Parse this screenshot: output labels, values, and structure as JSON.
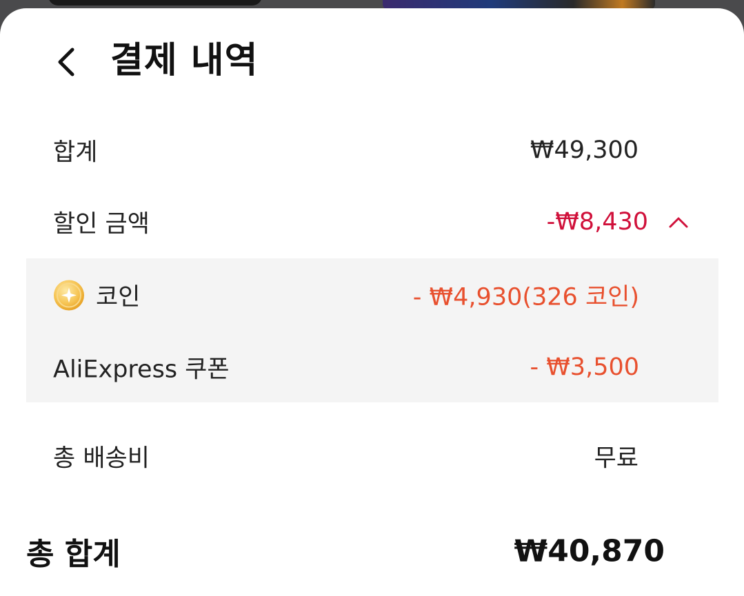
{
  "header": {
    "title": "결제 내역",
    "back_icon": "chevron-left-icon"
  },
  "summary": {
    "subtotal_label": "합계",
    "subtotal_value": "₩49,300",
    "discount_label": "할인 금액",
    "discount_value": "-₩8,430",
    "discount_toggle_icon": "chevron-up-icon",
    "discount_expanded": true,
    "discount_items": [
      {
        "icon": "coin-icon",
        "label": "코인",
        "value": "- ₩4,930(326 코인)"
      },
      {
        "label": "AliExpress 쿠폰",
        "value": "- ₩3,500"
      }
    ],
    "shipping_label": "총 배송비",
    "shipping_value": "무료",
    "total_label": "총 합계",
    "total_value": "₩40,870"
  },
  "colors": {
    "discount_red": "#d0103a",
    "discount_item_orange": "#e8502e",
    "discount_box_bg": "#f4f4f4",
    "coin_gold": "#f3b73a"
  }
}
